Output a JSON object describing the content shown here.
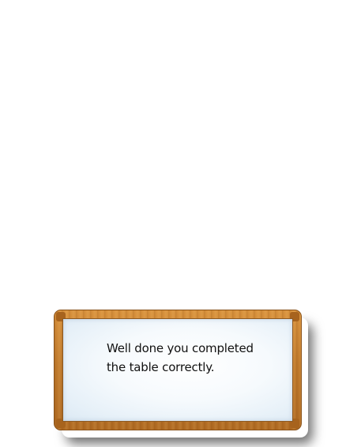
{
  "feedback": {
    "message_line1": "Well done you completed",
    "message_line2": "the table correctly."
  }
}
